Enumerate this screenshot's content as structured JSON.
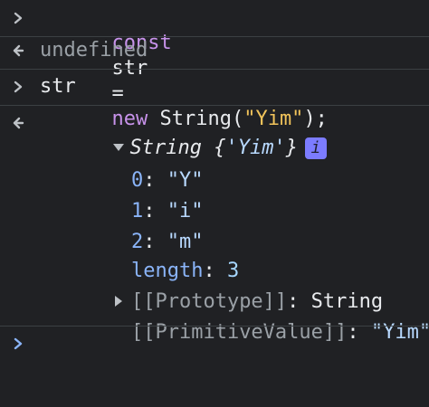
{
  "lines": {
    "l1": {
      "kw_const": "const",
      "var": "str",
      "op": "=",
      "kw_new": "new",
      "ctor": "String(",
      "literal": "\"Yim\"",
      "close": ");"
    },
    "l2": {
      "text": "undefined"
    },
    "l3": {
      "text": "str"
    },
    "l4": {
      "type": "String",
      "open": "{",
      "literal": "'Yim'",
      "close": "}",
      "badge": "i"
    },
    "props": [
      {
        "key": "0",
        "sep": ":",
        "value": "\"Y\""
      },
      {
        "key": "1",
        "sep": ":",
        "value": "\"i\""
      },
      {
        "key": "2",
        "sep": ":",
        "value": "\"m\""
      },
      {
        "key": "length",
        "sep": ":",
        "value": "3"
      }
    ],
    "proto": {
      "key": "[[Prototype]]",
      "sep": ":",
      "value": "String"
    },
    "primitive": {
      "key": "[[PrimitiveValue]]",
      "sep": ":",
      "value": "\"Yim\""
    }
  },
  "colors": {
    "background": "#202124",
    "keyword": "#c792ea",
    "string": "#f2c45b",
    "property_key": "#8ab4f8",
    "number": "#a6d7ff",
    "muted": "#9aa0a6",
    "badge": "#7c7cff",
    "prompt": "#8ab4f8"
  },
  "icons": {
    "input_prompt": "chevron-right-icon",
    "result_marker": "return-arrow-icon",
    "expanded": "triangle-down-icon",
    "collapsed": "triangle-right-icon",
    "info": "info-badge-icon"
  }
}
